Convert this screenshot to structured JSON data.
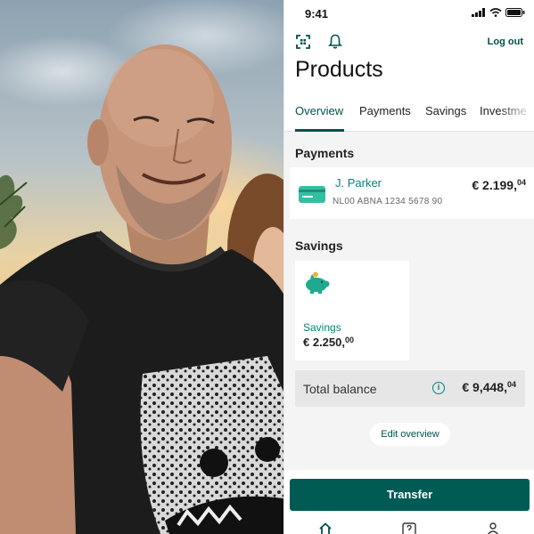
{
  "status_bar": {
    "time": "9:41"
  },
  "header": {
    "logout_label": "Log out",
    "title": "Products"
  },
  "tabs": [
    {
      "label": "Overview",
      "active": true
    },
    {
      "label": "Payments",
      "active": false
    },
    {
      "label": "Savings",
      "active": false
    },
    {
      "label": "Investme",
      "active": false
    }
  ],
  "payments": {
    "section_title": "Payments",
    "account": {
      "name": "J. Parker",
      "iban": "NL00 ABNA 1234 5678 90",
      "amount_main": "€ 2.199,",
      "amount_cents": "04"
    }
  },
  "savings": {
    "section_title": "Savings",
    "card": {
      "label": "Savings",
      "amount_main": "€ 2.250,",
      "amount_cents": "00"
    }
  },
  "total_balance": {
    "label": "Total balance",
    "info_glyph": "i",
    "amount_main": "€ 9,448,",
    "amount_cents": "04"
  },
  "edit_overview_label": "Edit overview",
  "transfer_label": "Transfer",
  "colors": {
    "brand": "#005b55",
    "accent": "#00857a",
    "card_icon": "#31c1a0"
  },
  "icons": [
    "qr-scan-icon",
    "bell-icon",
    "home-icon",
    "help-icon",
    "profile-icon"
  ]
}
